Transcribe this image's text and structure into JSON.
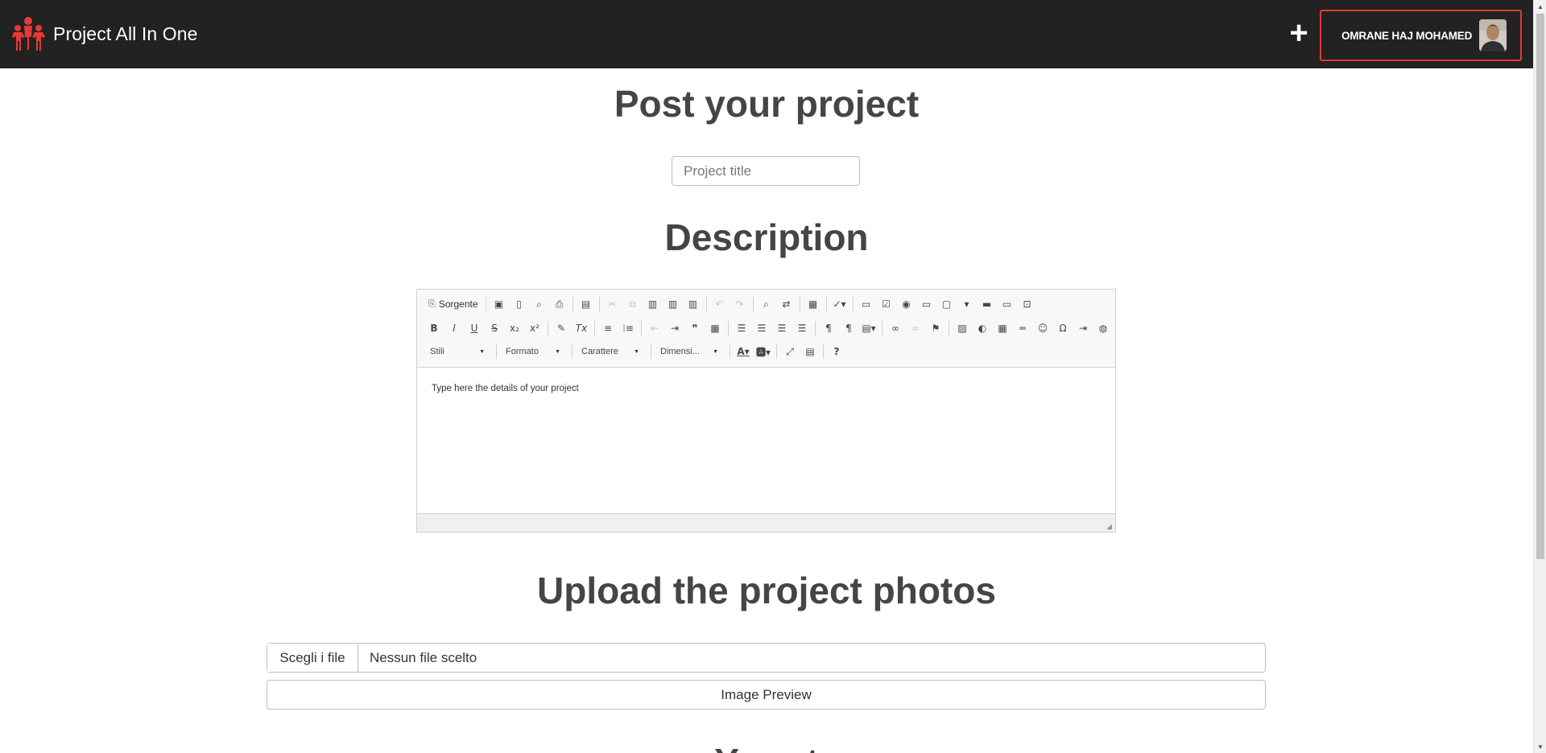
{
  "navbar": {
    "brand_name": "Project All In One",
    "add_label": "+",
    "user_name": "OMRANE HAJ MOHAMED"
  },
  "main": {
    "post_heading": "Post your project",
    "title_placeholder": "Project title",
    "description_heading": "Description",
    "upload_heading": "Upload the project photos",
    "next_heading_partial": "Your t"
  },
  "editor": {
    "source_label": "Sorgente",
    "combos": [
      "Stili",
      "Formato",
      "Carattere",
      "Dimensi..."
    ],
    "content_text": "Type here the details of your project",
    "row1_icons": [
      "save-icon",
      "new-page-icon",
      "preview-icon",
      "print-icon",
      "templates-icon",
      "cut-icon",
      "copy-icon",
      "paste-icon",
      "paste-text-icon",
      "paste-word-icon",
      "undo-icon",
      "redo-icon",
      "find-icon",
      "replace-icon",
      "select-all-icon",
      "spellcheck-icon",
      "form-icon",
      "checkbox-icon",
      "radio-icon",
      "textfield-icon",
      "textarea-icon",
      "select-icon",
      "button-icon",
      "image-button-icon",
      "hidden-field-icon"
    ],
    "row2_icons": [
      "bold-icon",
      "italic-icon",
      "underline-icon",
      "strike-icon",
      "subscript-icon",
      "superscript-icon",
      "copy-format-icon",
      "remove-format-icon",
      "numbered-list-icon",
      "bulleted-list-icon",
      "outdent-icon",
      "indent-icon",
      "blockquote-icon",
      "div-icon",
      "align-left-icon",
      "align-center-icon",
      "align-right-icon",
      "justify-icon",
      "ltr-icon",
      "rtl-icon",
      "language-icon",
      "link-icon",
      "unlink-icon",
      "anchor-icon",
      "image-icon",
      "flash-icon",
      "table-icon",
      "horizontal-rule-icon",
      "smiley-icon",
      "special-char-icon",
      "page-break-icon",
      "iframe-icon"
    ],
    "row3_icons": [
      "text-color-icon",
      "background-color-icon",
      "maximize-icon",
      "show-blocks-icon",
      "about-icon"
    ]
  },
  "upload": {
    "choose_files_label": "Scegli i file",
    "no_file_label": "Nessun file scelto",
    "preview_label": "Image Preview"
  },
  "colors": {
    "navbar_bg": "#222222",
    "accent": "#e53935"
  }
}
